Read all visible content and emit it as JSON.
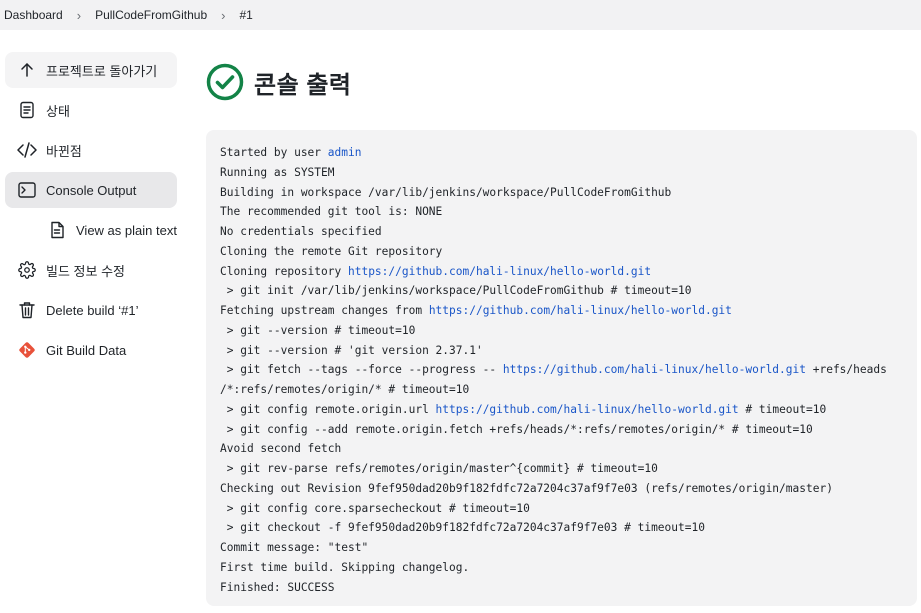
{
  "breadcrumb": {
    "items": [
      "Dashboard",
      "PullCodeFromGithub",
      "#1"
    ],
    "separator": "›"
  },
  "sidebar": {
    "items": [
      {
        "label": "프로젝트로 돌아가기",
        "icon": "arrow-up-icon"
      },
      {
        "label": "상태",
        "icon": "document-icon"
      },
      {
        "label": "바뀐점",
        "icon": "code-icon"
      },
      {
        "label": "Console Output",
        "icon": "terminal-icon"
      },
      {
        "label": "View as plain text",
        "icon": "document-icon"
      },
      {
        "label": "빌드 정보 수정",
        "icon": "gear-icon"
      },
      {
        "label": "Delete build ‘#1’",
        "icon": "trash-icon"
      },
      {
        "label": "Git Build Data",
        "icon": "git-icon"
      }
    ]
  },
  "main": {
    "title": "콘솔 출력",
    "status_icon": "success-check-icon",
    "status_color": "#138347"
  },
  "console": {
    "lines": [
      {
        "segments": [
          {
            "text": "Started by user "
          },
          {
            "text": "admin",
            "link": true
          }
        ]
      },
      {
        "segments": [
          {
            "text": "Running as SYSTEM"
          }
        ]
      },
      {
        "segments": [
          {
            "text": "Building in workspace /var/lib/jenkins/workspace/PullCodeFromGithub"
          }
        ]
      },
      {
        "segments": [
          {
            "text": "The recommended git tool is: NONE"
          }
        ]
      },
      {
        "segments": [
          {
            "text": "No credentials specified"
          }
        ]
      },
      {
        "segments": [
          {
            "text": "Cloning the remote Git repository"
          }
        ]
      },
      {
        "segments": [
          {
            "text": "Cloning repository "
          },
          {
            "text": "https://github.com/hali-linux/hello-world.git",
            "link": true
          }
        ]
      },
      {
        "segments": [
          {
            "text": " > git init /var/lib/jenkins/workspace/PullCodeFromGithub # timeout=10"
          }
        ]
      },
      {
        "segments": [
          {
            "text": "Fetching upstream changes from "
          },
          {
            "text": "https://github.com/hali-linux/hello-world.git",
            "link": true
          }
        ]
      },
      {
        "segments": [
          {
            "text": " > git --version # timeout=10"
          }
        ]
      },
      {
        "segments": [
          {
            "text": " > git --version # 'git version 2.37.1'"
          }
        ]
      },
      {
        "segments": [
          {
            "text": " > git fetch --tags --force --progress -- "
          },
          {
            "text": "https://github.com/hali-linux/hello-world.git",
            "link": true
          },
          {
            "text": " +refs/heads"
          }
        ]
      },
      {
        "segments": [
          {
            "text": "/*:refs/remotes/origin/* # timeout=10"
          }
        ]
      },
      {
        "segments": [
          {
            "text": " > git config remote.origin.url "
          },
          {
            "text": "https://github.com/hali-linux/hello-world.git",
            "link": true
          },
          {
            "text": " # timeout=10"
          }
        ]
      },
      {
        "segments": [
          {
            "text": " > git config --add remote.origin.fetch +refs/heads/*:refs/remotes/origin/* # timeout=10"
          }
        ]
      },
      {
        "segments": [
          {
            "text": "Avoid second fetch"
          }
        ]
      },
      {
        "segments": [
          {
            "text": " > git rev-parse refs/remotes/origin/master^{commit} # timeout=10"
          }
        ]
      },
      {
        "segments": [
          {
            "text": "Checking out Revision 9fef950dad20b9f182fdfc72a7204c37af9f7e03 (refs/remotes/origin/master)"
          }
        ]
      },
      {
        "segments": [
          {
            "text": " > git config core.sparsecheckout # timeout=10"
          }
        ]
      },
      {
        "segments": [
          {
            "text": " > git checkout -f 9fef950dad20b9f182fdfc72a7204c37af9f7e03 # timeout=10"
          }
        ]
      },
      {
        "segments": [
          {
            "text": "Commit message: \"test\""
          }
        ]
      },
      {
        "segments": [
          {
            "text": "First time build. Skipping changelog."
          }
        ]
      },
      {
        "segments": [
          {
            "text": "Finished: SUCCESS"
          }
        ]
      }
    ]
  }
}
